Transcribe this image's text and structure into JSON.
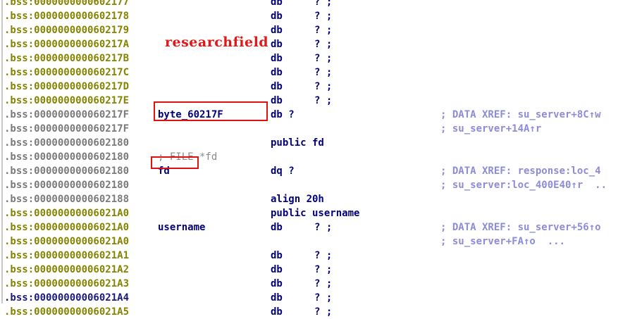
{
  "overlay_text": "researchfield",
  "rows": [
    {
      "addr": ".bss:0000000000602177",
      "addr_style": "olive",
      "label": "",
      "mnem": "db",
      "op": "? ;",
      "comment": ""
    },
    {
      "addr": ".bss:0000000000602178",
      "addr_style": "olive",
      "label": "",
      "mnem": "db",
      "op": "? ;",
      "comment": ""
    },
    {
      "addr": ".bss:0000000000602179",
      "addr_style": "olive",
      "label": "",
      "mnem": "db",
      "op": "? ;",
      "comment": ""
    },
    {
      "addr": ".bss:000000000060217A",
      "addr_style": "olive",
      "label": "",
      "mnem": "db",
      "op": "? ;",
      "comment": ""
    },
    {
      "addr": ".bss:000000000060217B",
      "addr_style": "olive",
      "label": "",
      "mnem": "db",
      "op": "? ;",
      "comment": ""
    },
    {
      "addr": ".bss:000000000060217C",
      "addr_style": "olive",
      "label": "",
      "mnem": "db",
      "op": "? ;",
      "comment": ""
    },
    {
      "addr": ".bss:000000000060217D",
      "addr_style": "olive",
      "label": "",
      "mnem": "db",
      "op": "? ;",
      "comment": ""
    },
    {
      "addr": ".bss:000000000060217E",
      "addr_style": "olive",
      "label": "",
      "mnem": "db",
      "op": "? ;",
      "comment": ""
    },
    {
      "addr": ".bss:000000000060217F",
      "addr_style": "gray",
      "label": "byte_60217F",
      "label_style": "",
      "mnem": "db ?",
      "op": "",
      "comment": "; DATA XREF: su_server+8C↑w"
    },
    {
      "addr": ".bss:000000000060217F",
      "addr_style": "gray",
      "label": "",
      "mnem": "",
      "op": "",
      "comment": "; su_server+14A↑r"
    },
    {
      "addr": ".bss:0000000000602180",
      "addr_style": "gray",
      "label": "",
      "mnem": "public fd",
      "op": "",
      "comment": ""
    },
    {
      "addr": ".bss:0000000000602180",
      "addr_style": "gray",
      "label": "; FILE *fd",
      "label_style": "dim",
      "mnem": "",
      "op": "",
      "comment": ""
    },
    {
      "addr": ".bss:0000000000602180",
      "addr_style": "gray",
      "label": "fd",
      "label_style": "",
      "mnem": "dq ?",
      "op": "",
      "comment": "; DATA XREF: response:loc_4"
    },
    {
      "addr": ".bss:0000000000602180",
      "addr_style": "gray",
      "label": "",
      "mnem": "",
      "op": "",
      "comment": "; su_server:loc_400E40↑r  .."
    },
    {
      "addr": ".bss:0000000000602188",
      "addr_style": "gray",
      "label": "",
      "mnem": "align 20h",
      "op": "",
      "comment": ""
    },
    {
      "addr": ".bss:00000000006021A0",
      "addr_style": "olive",
      "label": "",
      "mnem": "public username",
      "op": "",
      "comment": ""
    },
    {
      "addr": ".bss:00000000006021A0",
      "addr_style": "olive",
      "label": "username",
      "label_style": "",
      "mnem": "db",
      "op": "? ;",
      "comment": "; DATA XREF: su_server+56↑o"
    },
    {
      "addr": ".bss:00000000006021A0",
      "addr_style": "olive",
      "label": "",
      "mnem": "",
      "op": "",
      "comment": "; su_server+FA↑o  ..."
    },
    {
      "addr": ".bss:00000000006021A1",
      "addr_style": "olive",
      "label": "",
      "mnem": "db",
      "op": "? ;",
      "comment": ""
    },
    {
      "addr": ".bss:00000000006021A2",
      "addr_style": "olive",
      "label": "",
      "mnem": "db",
      "op": "? ;",
      "comment": ""
    },
    {
      "addr": ".bss:00000000006021A3",
      "addr_style": "olive",
      "label": "",
      "mnem": "db",
      "op": "? ;",
      "comment": ""
    },
    {
      "addr": ".bss:00000000006021A4",
      "addr_style": "navy",
      "label": "",
      "mnem": "db",
      "op": "? ;",
      "comment": ""
    },
    {
      "addr": ".bss:00000000006021A5",
      "addr_style": "olive",
      "label": "",
      "mnem": "db",
      "op": "? ;",
      "comment": ""
    }
  ],
  "colors": {
    "address": "#848400",
    "address_gray": "#7a7a7a",
    "instruction": "#000080",
    "comment": "#8c8cd8",
    "highlight": "#e01010"
  }
}
